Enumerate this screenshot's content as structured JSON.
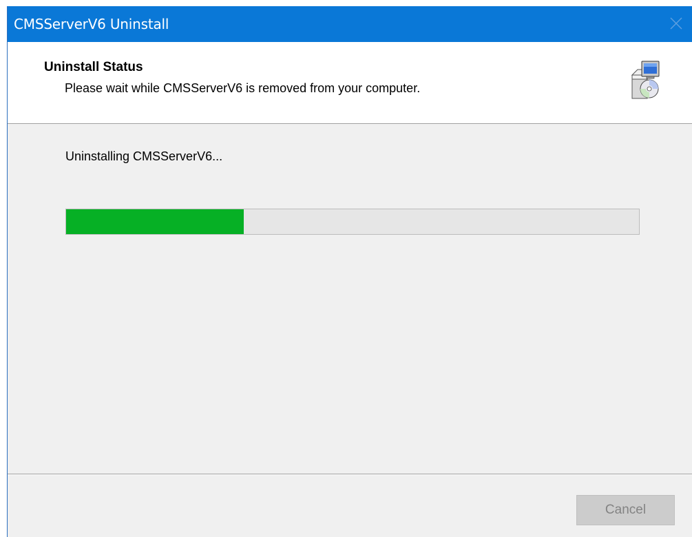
{
  "window": {
    "title": "CMSServerV6 Uninstall",
    "close_icon": "close-icon"
  },
  "header": {
    "title": "Uninstall Status",
    "subtitle": "Please wait while CMSServerV6 is removed from your computer.",
    "icon": "installer-computer-icon"
  },
  "main": {
    "status_text": "Uninstalling CMSServerV6...",
    "progress": 0.31
  },
  "footer": {
    "cancel_label": "Cancel",
    "cancel_enabled": false
  },
  "colors": {
    "titlebar": "#0a78d7",
    "progress_fill": "#06b025",
    "progress_track": "#e6e6e6"
  }
}
